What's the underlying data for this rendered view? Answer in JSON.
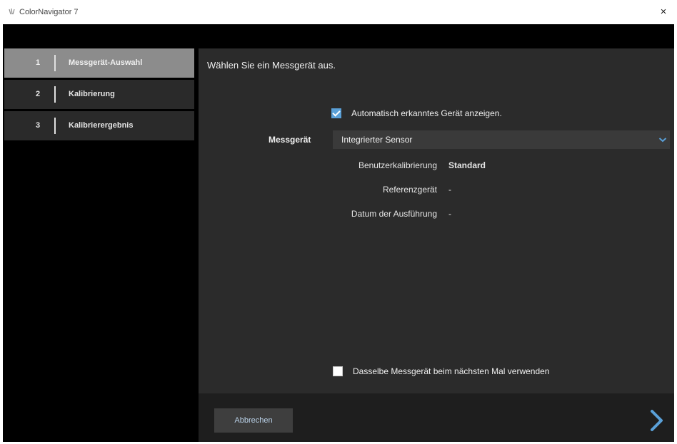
{
  "window": {
    "title": "ColorNavigator 7",
    "close_glyph": "×"
  },
  "steps": [
    {
      "number": "1",
      "label": "Messgerät-Auswahl",
      "active": true
    },
    {
      "number": "2",
      "label": "Kalibrierung",
      "active": false
    },
    {
      "number": "3",
      "label": "Kalibrierergebnis",
      "active": false
    }
  ],
  "main": {
    "instruction": "Wählen Sie ein Messgerät aus.",
    "auto_detect": {
      "label": "Automatisch erkanntes Gerät anzeigen.",
      "checked": true
    },
    "device": {
      "label": "Messgerät",
      "value": "Integrierter Sensor"
    },
    "info": [
      {
        "label": "Benutzerkalibrierung",
        "value": "Standard"
      },
      {
        "label": "Referenzgerät",
        "value": "-"
      },
      {
        "label": "Datum der Ausführung",
        "value": "-"
      }
    ],
    "same_device": {
      "label": "Dasselbe Messgerät beim nächsten Mal verwenden",
      "checked": false
    }
  },
  "footer": {
    "cancel_label": "Abbrechen"
  },
  "colors": {
    "accent": "#5aa0d8",
    "panel": "#2b2b2b",
    "active_step": "#8c8c8c"
  },
  "icons": {
    "app": "colornavigator-logo-icon",
    "dropdown": "chevron-down-icon",
    "next": "chevron-right-icon",
    "close": "close-icon"
  }
}
